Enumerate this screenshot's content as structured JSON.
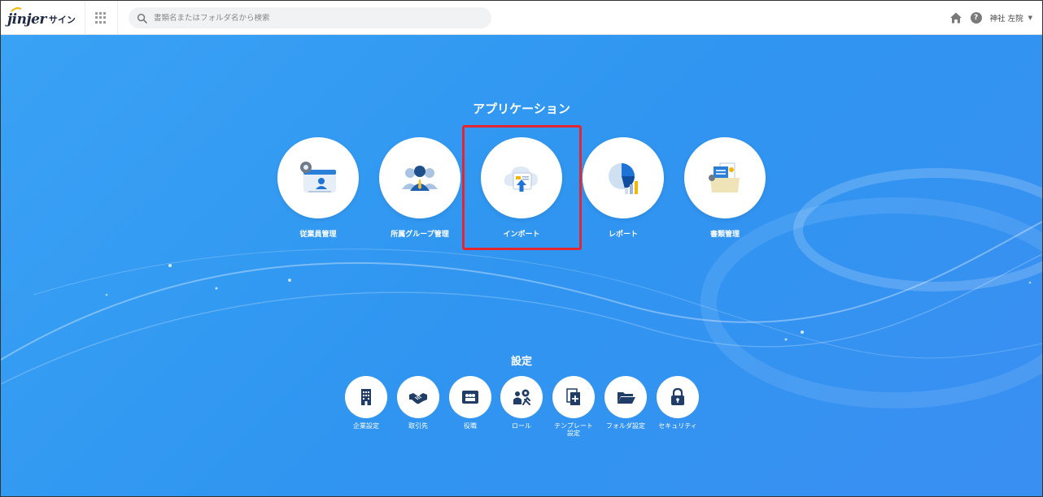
{
  "header": {
    "logo_text": "jinjer",
    "logo_sub": "サイン",
    "search_placeholder": "書類名またはフォルダ名から検索",
    "user_name": "神社 左院"
  },
  "apps": {
    "title": "アプリケーション",
    "items": [
      {
        "label": "従業員管理",
        "icon": "employee-card-icon"
      },
      {
        "label": "所属グループ管理",
        "icon": "group-people-icon"
      },
      {
        "label": "インポート",
        "icon": "cloud-upload-icon"
      },
      {
        "label": "レポート",
        "icon": "pie-chart-icon"
      },
      {
        "label": "書類管理",
        "icon": "document-folder-icon"
      }
    ]
  },
  "settings": {
    "title": "設定",
    "items": [
      {
        "label": "企業設定",
        "icon": "building-icon"
      },
      {
        "label": "取引先",
        "icon": "handshake-icon"
      },
      {
        "label": "役職",
        "icon": "org-chart-icon"
      },
      {
        "label": "ロール",
        "icon": "role-gear-icon"
      },
      {
        "label": "テンプレート設定",
        "icon": "template-add-icon"
      },
      {
        "label": "フォルダ設定",
        "icon": "folder-open-icon"
      },
      {
        "label": "セキュリティ",
        "icon": "lock-icon"
      }
    ]
  },
  "colors": {
    "background": "#3399f3",
    "accent_dark": "#1f2a44",
    "highlight": "#e3262f",
    "icon_blue": "#1e73d6"
  }
}
